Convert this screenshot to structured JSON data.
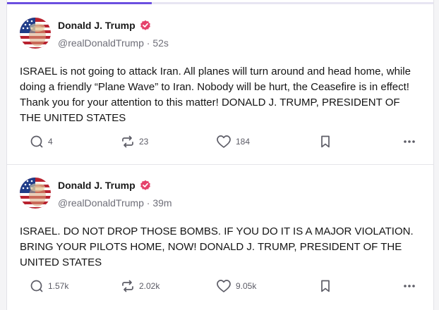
{
  "progress": {
    "fraction": 0.34,
    "color": "#6b4fe0"
  },
  "posts": [
    {
      "author": "Donald J. Trump",
      "handle": "@realDonaldTrump",
      "separator": "·",
      "time": "52s",
      "verified_icon": "verified-badge-icon",
      "text": "ISRAEL is not going to attack Iran. All planes will turn around and head home, while doing a friendly “Plane Wave” to Iran. Nobody will be hurt, the Ceasefire is in effect! Thank you for your attention to this matter! DONALD J. TRUMP, PRESIDENT OF THE UNITED STATES",
      "replies": "4",
      "retruths": "23",
      "likes": "184"
    },
    {
      "author": "Donald J. Trump",
      "handle": "@realDonaldTrump",
      "separator": "·",
      "time": "39m",
      "verified_icon": "verified-badge-icon",
      "text": "ISRAEL. DO NOT DROP THOSE BOMBS. IF YOU DO IT IS A MAJOR VIOLATION. BRING YOUR PILOTS HOME, NOW!  DONALD J. TRUMP, PRESIDENT OF THE UNITED STATES",
      "replies": "1.57k",
      "retruths": "2.02k",
      "likes": "9.05k"
    }
  ],
  "colors": {
    "verified": "#e5416b",
    "icon": "#5c5c66",
    "text": "#141414",
    "handle": "#6e6e78"
  },
  "icons": [
    "reply-icon",
    "retruth-icon",
    "like-icon",
    "bookmark-icon",
    "more-icon",
    "verified-badge-icon"
  ]
}
